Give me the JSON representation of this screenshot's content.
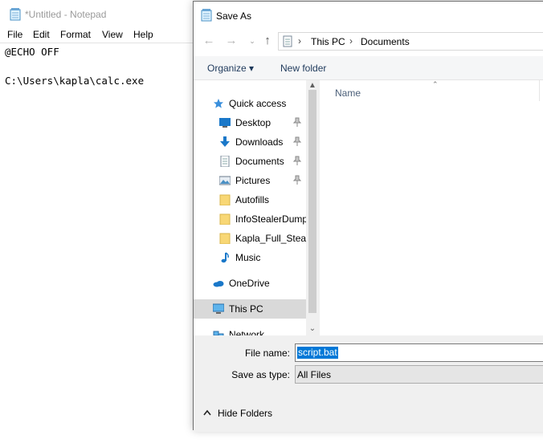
{
  "notepad": {
    "title": "*Untitled - Notepad",
    "menu": [
      "File",
      "Edit",
      "Format",
      "View",
      "Help"
    ],
    "lines": [
      "@ECHO OFF",
      "",
      "C:\\Users\\kapla\\calc.exe"
    ]
  },
  "dialog": {
    "title": "Save As",
    "breadcrumb": [
      "This PC",
      "Documents"
    ],
    "toolbar": {
      "organize": "Organize ▾",
      "new_folder": "New folder"
    },
    "nav": [
      {
        "label": "Quick access",
        "icon": "star-icon"
      },
      {
        "label": "Desktop",
        "icon": "desktop-icon",
        "pinned": true
      },
      {
        "label": "Downloads",
        "icon": "download-arrow-icon",
        "pinned": true
      },
      {
        "label": "Documents",
        "icon": "document-icon",
        "pinned": true
      },
      {
        "label": "Pictures",
        "icon": "pictures-icon",
        "pinned": true
      },
      {
        "label": "Autofills",
        "icon": "folder-icon"
      },
      {
        "label": "InfoStealerDump",
        "icon": "folder-icon"
      },
      {
        "label": "Kapla_Full_Stealer",
        "icon": "folder-icon"
      },
      {
        "label": "Music",
        "icon": "music-note-icon"
      },
      {
        "label": "OneDrive",
        "icon": "cloud-icon"
      },
      {
        "label": "This PC",
        "icon": "computer-icon",
        "selected": true
      },
      {
        "label": "Network",
        "icon": "network-icon"
      }
    ],
    "file_list": {
      "column_name": "Name"
    },
    "file_name_label": "File name:",
    "file_name_value": "script.bat",
    "save_as_type_label": "Save as type:",
    "save_as_type_value": "All Files",
    "hide_folders": "Hide Folders"
  },
  "colors": {
    "selection_blue": "#0078d7",
    "nav_selected": "#d9d9d9",
    "folder_yellow": "#f8d775",
    "link_blue": "#1e395b"
  }
}
